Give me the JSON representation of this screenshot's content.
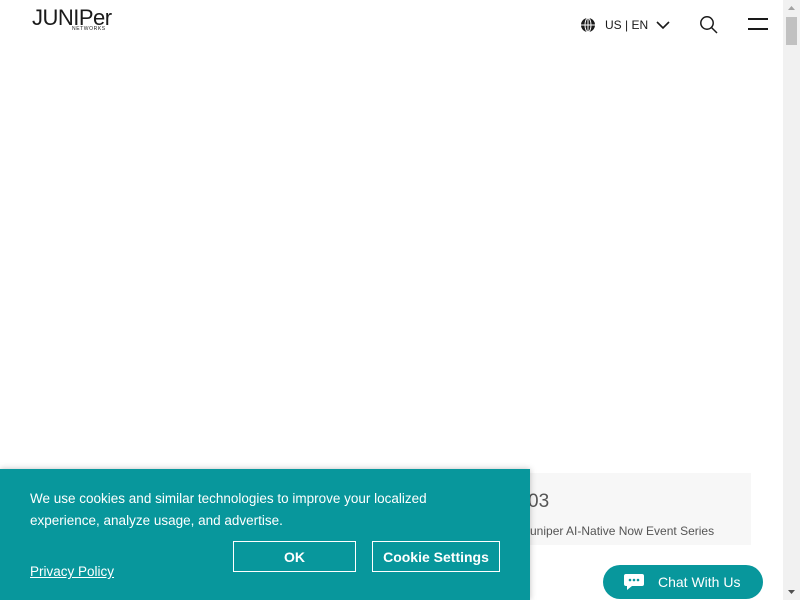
{
  "header": {
    "logo_word": "JUNIPer",
    "logo_sub": "NETWORKS",
    "locale_label": "US | EN"
  },
  "event_card": {
    "number": "03",
    "title": "Juniper AI-Native Now Event Series"
  },
  "cookie_banner": {
    "message": "We use cookies and similar technologies to improve your localized experience, analyze usage, and advertise.",
    "ok_label": "OK",
    "settings_label": "Cookie Settings",
    "privacy_label": "Privacy Policy"
  },
  "chat": {
    "label": "Chat With Us"
  },
  "colors": {
    "accent_teal": "#08979c",
    "text_dark": "#1a1a1a",
    "card_bg": "#f7f7f7"
  },
  "icons": {
    "globe": "globe-icon",
    "chevron": "chevron-down-icon",
    "search": "search-icon",
    "menu": "hamburger-menu-icon",
    "chat": "chat-bubble-icon"
  }
}
